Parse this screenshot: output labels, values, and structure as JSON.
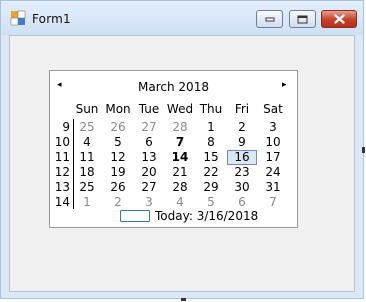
{
  "window": {
    "title": "Form1",
    "icon": "form-icon",
    "controls": [
      "minimize-icon",
      "maximize-icon",
      "close-icon"
    ]
  },
  "calendar": {
    "prev_arrow": "◂",
    "next_arrow": "▸",
    "month_title": "March 2018",
    "days_of_week": [
      "Sun",
      "Mon",
      "Tue",
      "Wed",
      "Thu",
      "Fri",
      "Sat"
    ],
    "weeks": [
      {
        "week": "9",
        "days": [
          {
            "d": "25",
            "gray": true
          },
          {
            "d": "26",
            "gray": true
          },
          {
            "d": "27",
            "gray": true
          },
          {
            "d": "28",
            "gray": true
          },
          {
            "d": "1"
          },
          {
            "d": "2"
          },
          {
            "d": "3"
          }
        ]
      },
      {
        "week": "10",
        "days": [
          {
            "d": "4"
          },
          {
            "d": "5"
          },
          {
            "d": "6"
          },
          {
            "d": "7",
            "bold": true
          },
          {
            "d": "8"
          },
          {
            "d": "9"
          },
          {
            "d": "10"
          }
        ]
      },
      {
        "week": "11",
        "days": [
          {
            "d": "11"
          },
          {
            "d": "12"
          },
          {
            "d": "13"
          },
          {
            "d": "14",
            "bold": true
          },
          {
            "d": "15"
          },
          {
            "d": "16",
            "selected": true
          },
          {
            "d": "17"
          }
        ]
      },
      {
        "week": "12",
        "days": [
          {
            "d": "18"
          },
          {
            "d": "19"
          },
          {
            "d": "20"
          },
          {
            "d": "21"
          },
          {
            "d": "22"
          },
          {
            "d": "23"
          },
          {
            "d": "24"
          }
        ]
      },
      {
        "week": "13",
        "days": [
          {
            "d": "25"
          },
          {
            "d": "26"
          },
          {
            "d": "27"
          },
          {
            "d": "28"
          },
          {
            "d": "29"
          },
          {
            "d": "30"
          },
          {
            "d": "31"
          }
        ]
      },
      {
        "week": "14",
        "days": [
          {
            "d": "1",
            "gray": true
          },
          {
            "d": "2",
            "gray": true
          },
          {
            "d": "3",
            "gray": true
          },
          {
            "d": "4",
            "gray": true
          },
          {
            "d": "5",
            "gray": true
          },
          {
            "d": "6",
            "gray": true
          },
          {
            "d": "7",
            "gray": true
          }
        ]
      }
    ],
    "today_label": "Today: 3/16/2018"
  },
  "colors": {
    "window_border": "#a9c3e3",
    "client_bg": "#f0f0f0",
    "close_red": "#c3402a",
    "selected_day_bg": "#dbe7f3",
    "today_box_border": "#3c74ad"
  }
}
